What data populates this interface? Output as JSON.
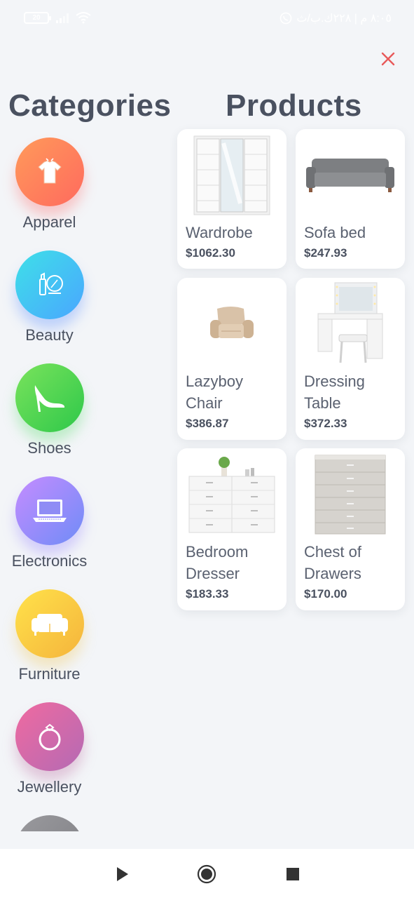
{
  "status": {
    "battery": "20",
    "right_text": "٨:٠٥ م | ٢٢٨ك.ب/ث"
  },
  "headings": {
    "categories": "Categories",
    "products": "Products"
  },
  "close_icon": "close-icon",
  "categories": [
    {
      "label": "Apparel",
      "icon": "tshirt-icon",
      "color_from": "#ff9a5a",
      "color_to": "#ff6a5e",
      "glow": "#ff8c8c"
    },
    {
      "label": "Beauty",
      "icon": "makeup-icon",
      "color_from": "#3ee0e8",
      "color_to": "#4aa6ff",
      "glow": "#6aa8ff"
    },
    {
      "label": "Shoes",
      "icon": "high-heel-icon",
      "color_from": "#7ae35c",
      "color_to": "#2ec84a",
      "glow": "#74e07c"
    },
    {
      "label": "Electronics",
      "icon": "laptop-icon",
      "color_from": "#c58cff",
      "color_to": "#6f8cf7",
      "glow": "#9a8cff"
    },
    {
      "label": "Furniture",
      "icon": "sofa-icon",
      "color_from": "#ffe24a",
      "color_to": "#f5b43c",
      "glow": "#f7d36a"
    },
    {
      "label": "Jewellery",
      "icon": "ring-icon",
      "color_from": "#f06aa0",
      "color_to": "#b46ab4",
      "glow": "#c07aa8"
    },
    {
      "label": "",
      "icon": "more-icon",
      "color_from": "#9a9a9e",
      "color_to": "#7d7d82",
      "glow": "#aaaaaa"
    }
  ],
  "products": [
    {
      "name": "Wardrobe",
      "price": "$1062.30",
      "icon": "wardrobe-image"
    },
    {
      "name": "Sofa bed",
      "price": "$247.93",
      "icon": "sofa-bed-image"
    },
    {
      "name": "Lazyboy Chair",
      "price": "$386.87",
      "icon": "recliner-image"
    },
    {
      "name": "Dressing Table",
      "price": "$372.33",
      "icon": "dressing-table-image"
    },
    {
      "name": "Bedroom Dresser",
      "price": "$183.33",
      "icon": "dresser-image"
    },
    {
      "name": "Chest of Drawers",
      "price": "$170.00",
      "icon": "chest-drawers-image"
    }
  ],
  "nav": [
    "back-play-icon",
    "home-circle-icon",
    "recents-square-icon"
  ]
}
